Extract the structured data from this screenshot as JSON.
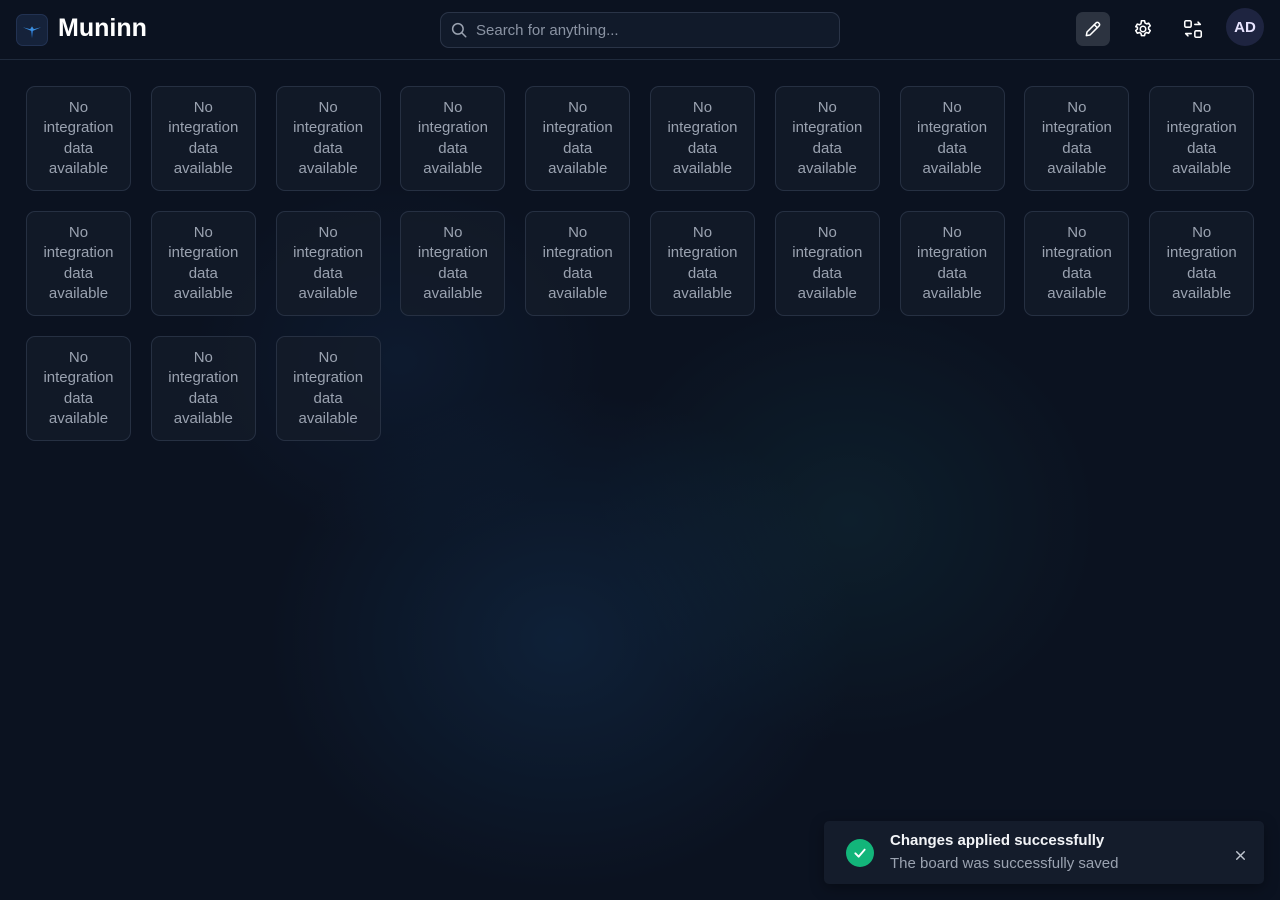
{
  "app": {
    "title": "Muninn",
    "logo_icon": "raven-bird-icon"
  },
  "header": {
    "search_placeholder": "Search for anything...",
    "buttons": [
      {
        "icon": "pencil-icon",
        "active": true
      },
      {
        "icon": "gear-icon"
      },
      {
        "icon": "swap-layout-icon"
      }
    ],
    "avatar": {
      "initials": "AD"
    }
  },
  "board": {
    "tiles": [
      {
        "text": "No integration data available"
      },
      {
        "text": "No integration data available"
      },
      {
        "text": "No integration data available"
      },
      {
        "text": "No integration data available"
      },
      {
        "text": "No integration data available"
      },
      {
        "text": "No integration data available"
      },
      {
        "text": "No integration data available"
      },
      {
        "text": "No integration data available"
      },
      {
        "text": "No integration data available"
      },
      {
        "text": "No integration data available"
      },
      {
        "text": "No integration data available"
      },
      {
        "text": "No integration data available"
      },
      {
        "text": "No integration data available"
      },
      {
        "text": "No integration data available"
      },
      {
        "text": "No integration data available"
      },
      {
        "text": "No integration data available"
      },
      {
        "text": "No integration data available"
      },
      {
        "text": "No integration data available"
      },
      {
        "text": "No integration data available"
      },
      {
        "text": "No integration data available"
      },
      {
        "text": "No integration data available"
      },
      {
        "text": "No integration data available"
      },
      {
        "text": "No integration data available"
      }
    ]
  },
  "toast": {
    "title": "Changes applied successfully",
    "message": "The board was successfully saved",
    "status_icon": "check-icon",
    "close_icon": "close-icon",
    "accent_color": "#13b57a"
  }
}
